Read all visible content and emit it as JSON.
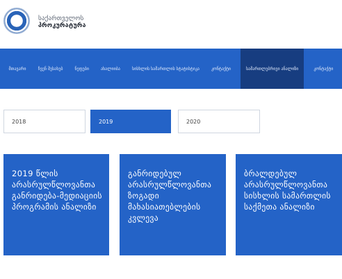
{
  "header": {
    "logo_line1": "საქართველოს",
    "logo_line2": "პროკურატურა"
  },
  "nav": {
    "items": [
      "მთავარი",
      "ჩვენ შესახებ",
      "ნეფები",
      "ახალიიბა",
      "სისხლის სამართლის სტატისტიკა",
      "კონტაქტი",
      "სამართლებრივი ანალიზი",
      "კონტაქტი"
    ],
    "active_index": 6
  },
  "years": {
    "items": [
      "2018",
      "2019",
      "2020"
    ],
    "selected": "2019"
  },
  "cards": [
    {
      "title": "2019 წლის არასრულწლოვანთა განრიდება-მედიაციის პროგრამის ანალიზი"
    },
    {
      "title": "განრიდებულ არასრულწლოვანთა ზოგადი მახასიათებლების კვლევა"
    },
    {
      "title": "ბრალდებულ არასრულწლოვანთა სისხლის სამართლის საქმეთა ანალიზი"
    }
  ],
  "colors": {
    "primary": "#2463c7",
    "nav_active": "#173d80"
  }
}
